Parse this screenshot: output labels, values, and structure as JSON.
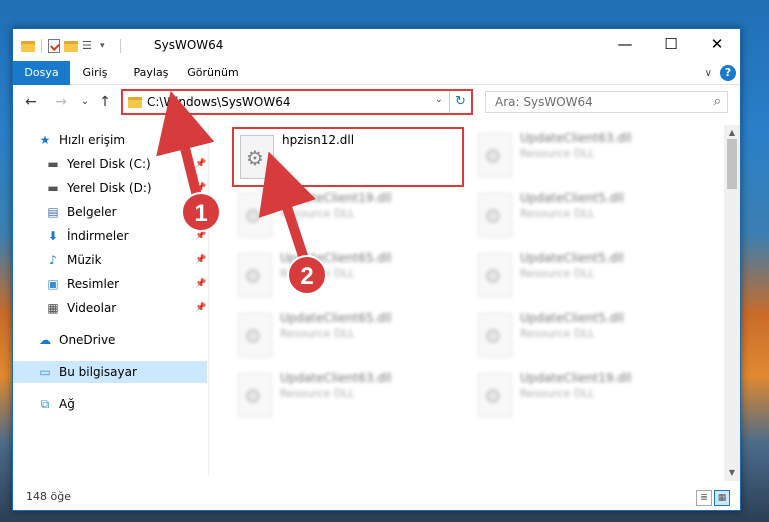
{
  "window": {
    "title": "SysWOW64",
    "controls": {
      "minimize": "—",
      "maximize": "☐",
      "close": "✕"
    }
  },
  "ribbon": {
    "tabs": [
      "Dosya",
      "Giriş",
      "Paylaş",
      "Görünüm"
    ]
  },
  "nav": {
    "back": "←",
    "forward": "→",
    "recent": "⌄",
    "up": "↑",
    "address": "C:\\Windows\\SysWOW64",
    "search_placeholder": "Ara: SysWOW64"
  },
  "sidebar": {
    "items": [
      {
        "label": "Hızlı erişim",
        "icon": "star-icon",
        "pinned": false
      },
      {
        "label": "Yerel Disk (C:)",
        "icon": "drive-icon",
        "pinned": true
      },
      {
        "label": "Yerel Disk (D:)",
        "icon": "drive-icon",
        "pinned": true
      },
      {
        "label": "Belgeler",
        "icon": "documents-icon",
        "pinned": true
      },
      {
        "label": "İndirmeler",
        "icon": "download-icon",
        "pinned": true
      },
      {
        "label": "Müzik",
        "icon": "music-icon",
        "pinned": true
      },
      {
        "label": "Resimler",
        "icon": "pictures-icon",
        "pinned": true
      },
      {
        "label": "Videolar",
        "icon": "video-icon",
        "pinned": true
      },
      {
        "label": "OneDrive",
        "icon": "cloud-icon",
        "pinned": false
      },
      {
        "label": "Bu bilgisayar",
        "icon": "computer-icon",
        "pinned": false
      },
      {
        "label": "Ağ",
        "icon": "network-icon",
        "pinned": false
      }
    ]
  },
  "files": [
    {
      "name": "hpzisn12.dll",
      "type": ""
    },
    {
      "name": "UpdateClient63.dll",
      "type": "Resource DLL"
    },
    {
      "name": "UpdateClient19.dll",
      "type": "Resource DLL"
    },
    {
      "name": "UpdateClient5.dll",
      "type": "Resource DLL"
    },
    {
      "name": "UpdateClient65.dll",
      "type": "Resource DLL"
    },
    {
      "name": "UpdateClient5.dll",
      "type": "Resource DLL"
    },
    {
      "name": "UpdateClient65.dll",
      "type": "Resource DLL"
    },
    {
      "name": "UpdateClient5.dll",
      "type": "Resource DLL"
    },
    {
      "name": "UpdateClient63.dll",
      "type": "Resource DLL"
    },
    {
      "name": "UpdateClient19.dll",
      "type": "Resource DLL"
    }
  ],
  "status": {
    "count": "148 öğe"
  },
  "annotations": {
    "badge1": "1",
    "badge2": "2",
    "color": "#d83b3b"
  }
}
